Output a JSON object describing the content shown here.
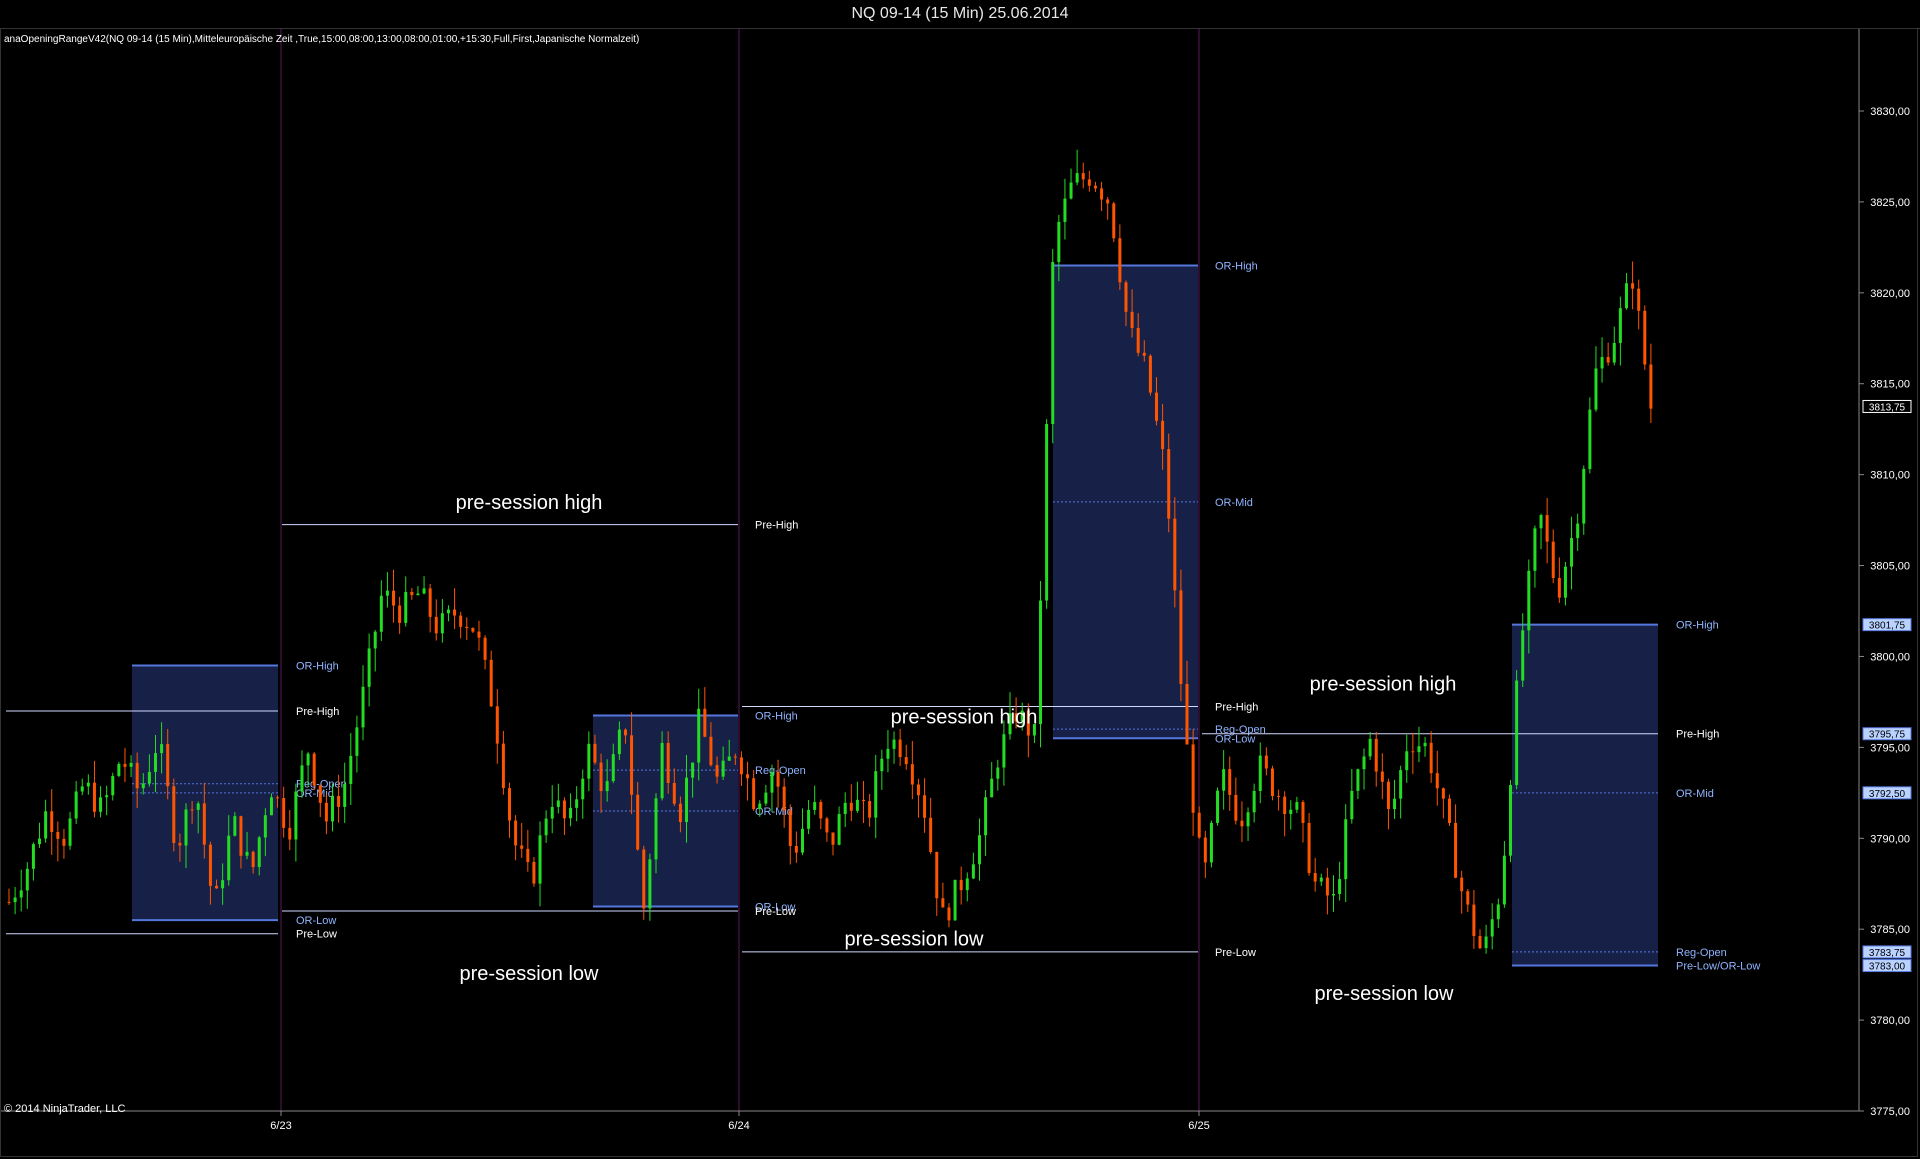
{
  "window": {
    "title": "NQ 09-14 (15 Min)  25.06.2014"
  },
  "indicator_label": "anaOpeningRangeV42(NQ 09-14 (15 Min),Mitteleuropäische Zeit ,True,15:00,08:00,13:00,08:00,01:00,+15:30,Full,First,Japanische Normalzeit)",
  "copyright": "© 2014 NinjaTrader, LLC",
  "colors": {
    "background": "#000000",
    "up_candle": "#22dd22",
    "down_candle": "#ff5500",
    "or_box": "#1a2550",
    "or_line": "#5577dd",
    "pre_line": "#cfd8ff",
    "session_separator": "#5a1a5a",
    "text_white": "#ffffff",
    "price_label": "#8fb4ff"
  },
  "chart_data": {
    "type": "candlestick",
    "instrument": "NQ 09-14",
    "interval": "15 Min",
    "y_axis": {
      "min": 3775,
      "max": 3830,
      "ticks": [
        "3775,00",
        "3780,00",
        "3785,00",
        "3790,00",
        "3795,00",
        "3800,00",
        "3805,00",
        "3810,00",
        "3815,00",
        "3820,00",
        "3825,00",
        "3830,00"
      ],
      "tick_values": [
        3775,
        3780,
        3785,
        3790,
        3795,
        3800,
        3805,
        3810,
        3815,
        3820,
        3825,
        3830
      ]
    },
    "x_axis": {
      "date_labels": [
        "6/23",
        "6/24",
        "6/25"
      ]
    },
    "price_markers": [
      {
        "text": "3813,75",
        "value": 3813.75,
        "style": "current"
      },
      {
        "text": "3801,75",
        "value": 3801.75,
        "style": "level"
      },
      {
        "text": "3795,75",
        "value": 3795.75,
        "style": "level"
      },
      {
        "text": "3792,50",
        "value": 3792.5,
        "style": "level"
      },
      {
        "text": "3783,75",
        "value": 3783.75,
        "style": "level"
      },
      {
        "text": "3783,00",
        "value": 3783.0,
        "style": "level"
      }
    ],
    "session_levels": [
      {
        "session": 1,
        "lines": [
          {
            "label": "OR-High",
            "value": 3799.5,
            "type": "or"
          },
          {
            "label": "Pre-High",
            "value": 3797.0,
            "type": "pre"
          },
          {
            "label": "Reg-Open",
            "value": 3793.0,
            "type": "mid"
          },
          {
            "label": "OR-Mid",
            "value": 3792.5,
            "type": "mid"
          },
          {
            "label": "OR-Low",
            "value": 3785.5,
            "type": "or"
          },
          {
            "label": "Pre-Low",
            "value": 3784.75,
            "type": "pre"
          }
        ]
      },
      {
        "session": 2,
        "lines": [
          {
            "label": "Pre-High",
            "value": 3807.25,
            "type": "pre"
          },
          {
            "label": "OR-High",
            "value": 3796.75,
            "type": "or"
          },
          {
            "label": "Reg-Open",
            "value": 3793.75,
            "type": "mid"
          },
          {
            "label": "OR-Mid",
            "value": 3791.5,
            "type": "mid"
          },
          {
            "label": "OR-Low",
            "value": 3786.25,
            "type": "or"
          },
          {
            "label": "Pre-Low",
            "value": 3786.0,
            "type": "pre"
          }
        ]
      },
      {
        "session": 3,
        "lines": [
          {
            "label": "OR-High",
            "value": 3821.5,
            "type": "or"
          },
          {
            "label": "OR-Mid",
            "value": 3808.5,
            "type": "mid"
          },
          {
            "label": "Pre-High",
            "value": 3797.25,
            "type": "pre"
          },
          {
            "label": "Reg-Open",
            "value": 3796.0,
            "type": "mid"
          },
          {
            "label": "OR-Low",
            "value": 3795.5,
            "type": "or"
          },
          {
            "label": "Pre-Low",
            "value": 3783.75,
            "type": "pre"
          }
        ]
      },
      {
        "session": 4,
        "lines": [
          {
            "label": "OR-High",
            "value": 3801.75,
            "type": "or"
          },
          {
            "label": "Pre-High",
            "value": 3795.75,
            "type": "pre"
          },
          {
            "label": "OR-Mid",
            "value": 3792.5,
            "type": "mid"
          },
          {
            "label": "Reg-Open",
            "value": 3783.75,
            "type": "mid"
          },
          {
            "label": "Pre-Low/OR-Low",
            "value": 3783.0,
            "type": "or"
          }
        ]
      }
    ],
    "annotations": [
      {
        "text": "pre-session high",
        "value": 3808.5
      },
      {
        "text": "pre-session low",
        "value": 3784.5
      },
      {
        "text": "pre-session high",
        "value": 3798.5
      },
      {
        "text": "pre-session low",
        "value": 3782.6
      },
      {
        "text": "pre-session high",
        "value": 3796.7
      },
      {
        "text": "pre-session low",
        "value": 3781.5
      }
    ],
    "price_path": [
      3786.5,
      3788.5,
      3791.5,
      3790.0,
      3793.0,
      3791.5,
      3794.5,
      3792.5,
      3795.5,
      3789.5,
      3793.0,
      3786.0,
      3791.0,
      3788.0,
      3793.0,
      3790.5,
      3795.0,
      3791.0,
      3793.0,
      3798.0,
      3803.5,
      3802.5,
      3803.5,
      3801.5,
      3802.5,
      3801.5,
      3797.0,
      3790.0,
      3787.5,
      3792.5,
      3790.5,
      3795.0,
      3792.5,
      3796.5,
      3786.0,
      3795.0,
      3791.5,
      3796.5,
      3793.0,
      3795.0,
      3792.0,
      3794.0,
      3789.0,
      3792.0,
      3789.5,
      3792.5,
      3791.0,
      3795.5,
      3795.0,
      3792.0,
      3785.5,
      3787.5,
      3790.0,
      3794.5,
      3797.0,
      3795.5,
      3823.0,
      3826.0,
      3826.5,
      3825.0,
      3818.0,
      3815.5,
      3810.0,
      3796.0,
      3787.5,
      3793.5,
      3791.0,
      3794.0,
      3792.5,
      3791.5,
      3787.5,
      3786.5,
      3792.5,
      3795.5,
      3791.0,
      3795.5,
      3795.0,
      3791.0,
      3786.5,
      3783.5,
      3787.5,
      3800.5,
      3808.0,
      3803.5,
      3807.5,
      3815.5,
      3817.5,
      3821.0,
      3813.75
    ]
  }
}
